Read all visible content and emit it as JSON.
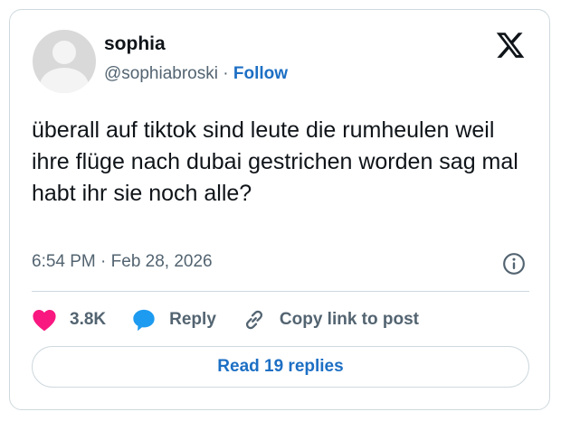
{
  "author": {
    "name": "sophia",
    "handle": "@sophiabroski",
    "separator": "·",
    "follow_label": "Follow"
  },
  "icons": {
    "avatar": "default-avatar-icon",
    "logo": "x-logo-icon",
    "info": "info-icon",
    "like": "heart-icon",
    "reply": "speech-bubble-icon",
    "copy": "link-icon"
  },
  "tweet": {
    "text": "überall auf tiktok sind leute die rumheulen weil ihre flüge nach dubai gestrichen worden sag mal habt ihr sie noch alle?"
  },
  "meta": {
    "timestamp": "6:54 PM · Feb 28, 2026"
  },
  "actions": {
    "likes": "3.8K",
    "reply_label": "Reply",
    "copy_label": "Copy link to post"
  },
  "footer": {
    "read_replies_label": "Read 19 replies"
  },
  "colors": {
    "accent": "#1d6fc4",
    "like": "#f91880",
    "reply_icon": "#1d9bf0",
    "muted": "#536471",
    "border": "#cfd9de"
  }
}
